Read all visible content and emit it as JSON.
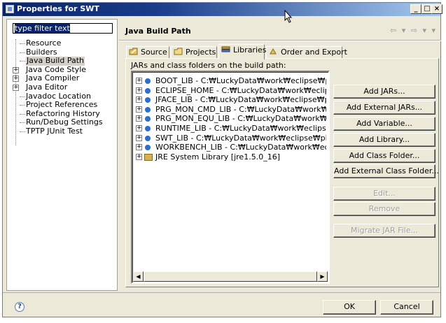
{
  "window": {
    "title": "Properties for SWT",
    "controls": [
      "_",
      "□",
      "×"
    ]
  },
  "filter": {
    "value": "type filter text"
  },
  "tree": [
    {
      "label": "Resource",
      "expandable": false,
      "selected": false
    },
    {
      "label": "Builders",
      "expandable": false,
      "selected": false
    },
    {
      "label": "Java Build Path",
      "expandable": false,
      "selected": true
    },
    {
      "label": "Java Code Style",
      "expandable": true,
      "selected": false
    },
    {
      "label": "Java Compiler",
      "expandable": true,
      "selected": false
    },
    {
      "label": "Java Editor",
      "expandable": true,
      "selected": false
    },
    {
      "label": "Javadoc Location",
      "expandable": false,
      "selected": false
    },
    {
      "label": "Project References",
      "expandable": false,
      "selected": false
    },
    {
      "label": "Refactoring History",
      "expandable": false,
      "selected": false
    },
    {
      "label": "Run/Debug Settings",
      "expandable": false,
      "selected": false
    },
    {
      "label": "TPTP JUnit Test",
      "expandable": false,
      "selected": false
    }
  ],
  "page": {
    "title": "Java Build Path",
    "nav": "⇦ ▾ ⇨ ▾ ▾"
  },
  "tabs": [
    {
      "label": "Source",
      "icon": "source-folder-icon",
      "active": false
    },
    {
      "label": "Projects",
      "icon": "projects-icon",
      "active": false
    },
    {
      "label": "Libraries",
      "icon": "libraries-icon",
      "active": true
    },
    {
      "label": "Order and Export",
      "icon": "order-export-icon",
      "active": false
    }
  ],
  "libraries": {
    "label": "JARs and class folders on the build path:",
    "items": [
      {
        "text": "BOOT_LIB - C:₩LuckyData₩work₩eclipse₩plugin",
        "icon": "variable-icon"
      },
      {
        "text": "ECLIPSE_HOME - C:₩LuckyData₩work₩eclipse",
        "icon": "variable-icon"
      },
      {
        "text": "JFACE_LIB - C:₩LuckyData₩work₩eclipse₩plugi",
        "icon": "variable-icon"
      },
      {
        "text": "PRG_MON_CMD_LIB - C:₩LuckyData₩work₩eclip",
        "icon": "variable-icon"
      },
      {
        "text": "PRG_MON_EQU_LIB - C:₩LuckyData₩work₩eclip",
        "icon": "variable-icon"
      },
      {
        "text": "RUNTIME_LIB - C:₩LuckyData₩work₩eclipse₩pl",
        "icon": "variable-icon"
      },
      {
        "text": "SWT_LIB - C:₩LuckyData₩work₩eclipse₩plugins",
        "icon": "variable-icon"
      },
      {
        "text": "WORKBENCH_LIB - C:₩LuckyData₩work₩eclipse",
        "icon": "variable-icon"
      },
      {
        "text": "JRE System Library [jre1.5.0_16]",
        "icon": "library-icon"
      }
    ]
  },
  "buttons": [
    {
      "label": "Add JARs...",
      "enabled": true
    },
    {
      "label": "Add External JARs...",
      "enabled": true
    },
    {
      "label": "Add Variable...",
      "enabled": true
    },
    {
      "label": "Add Library...",
      "enabled": true
    },
    {
      "label": "Add Class Folder...",
      "enabled": true
    },
    {
      "label": "Add External Class Folder...",
      "enabled": true
    },
    {
      "label": "Edit...",
      "enabled": false
    },
    {
      "label": "Remove",
      "enabled": false
    },
    {
      "label": "Migrate JAR File...",
      "enabled": false
    }
  ],
  "footer": {
    "help": "?",
    "ok_label": "OK",
    "cancel_label": "Cancel"
  }
}
